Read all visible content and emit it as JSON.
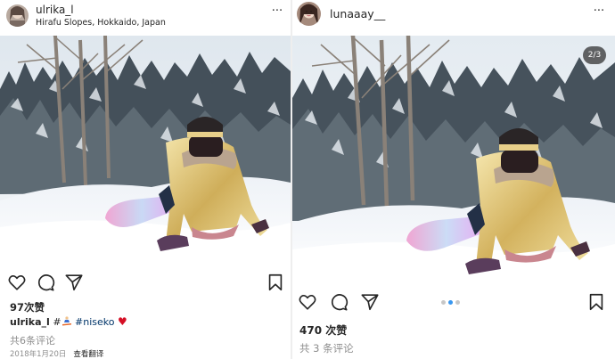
{
  "posts": [
    {
      "username": "ulrika_l",
      "location": "Hirafu Slopes, Hokkaido, Japan",
      "more_label": "···",
      "likes": "97次赞",
      "caption": {
        "user": "ulrika_l",
        "text": "#",
        "emoji1": "snowboarder",
        "hashtag": "#niseko",
        "emoji2": "♥"
      },
      "comments": "共6条评论",
      "date": "2018年1月20日",
      "translate": "查看翻译",
      "icons": [
        "heart-icon",
        "comment-icon",
        "share-icon",
        "bookmark-icon"
      ]
    },
    {
      "username": "lunaaay__",
      "more_label": "···",
      "counter": "2/3",
      "carousel": {
        "total": 3,
        "active": 2
      },
      "likes": "470 次赞",
      "comments": "共 3 条评论",
      "icons": [
        "heart-icon",
        "comment-icon",
        "share-icon",
        "bookmark-icon"
      ]
    }
  ],
  "colors": {
    "link": "#003569",
    "muted": "#8e8e8e",
    "text": "#262626",
    "carousel_active": "#3897f0",
    "jacket": "#d9c07a"
  }
}
